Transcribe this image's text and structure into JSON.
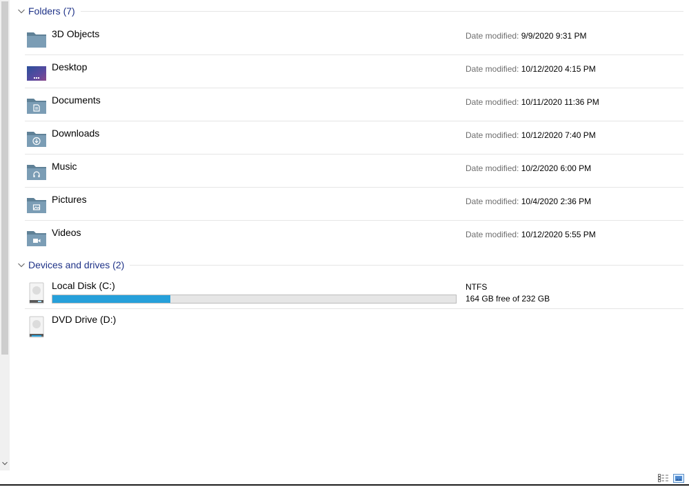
{
  "colors": {
    "group_title": "#1e3287",
    "progress_fill": "#26a0da",
    "folder": "#7b9db5",
    "folder_dark": "#5f8197"
  },
  "folders_group": {
    "title": "Folders (7)",
    "items": [
      {
        "name": "3D Objects",
        "icon": "3d-objects-folder-icon",
        "date_label": "Date modified:",
        "date": "9/9/2020 9:31 PM"
      },
      {
        "name": "Desktop",
        "icon": "desktop-folder-icon",
        "date_label": "Date modified:",
        "date": "10/12/2020 4:15 PM"
      },
      {
        "name": "Documents",
        "icon": "documents-folder-icon",
        "date_label": "Date modified:",
        "date": "10/11/2020 11:36 PM"
      },
      {
        "name": "Downloads",
        "icon": "downloads-folder-icon",
        "date_label": "Date modified:",
        "date": "10/12/2020 7:40 PM"
      },
      {
        "name": "Music",
        "icon": "music-folder-icon",
        "date_label": "Date modified:",
        "date": "10/2/2020 6:00 PM"
      },
      {
        "name": "Pictures",
        "icon": "pictures-folder-icon",
        "date_label": "Date modified:",
        "date": "10/4/2020 2:36 PM"
      },
      {
        "name": "Videos",
        "icon": "videos-folder-icon",
        "date_label": "Date modified:",
        "date": "10/12/2020 5:55 PM"
      }
    ]
  },
  "drives_group": {
    "title": "Devices and drives (2)",
    "drives": [
      {
        "name": "Local Disk (C:)",
        "icon": "hard-disk-icon",
        "filesystem": "NTFS",
        "free_text": "164 GB free of 232 GB",
        "used_fraction": 0.293
      },
      {
        "name": "DVD Drive (D:)",
        "icon": "dvd-drive-icon"
      }
    ]
  },
  "statusbar": {
    "details_view_icon": "details-view-icon",
    "large_icons_view_icon": "large-icons-view-icon"
  }
}
